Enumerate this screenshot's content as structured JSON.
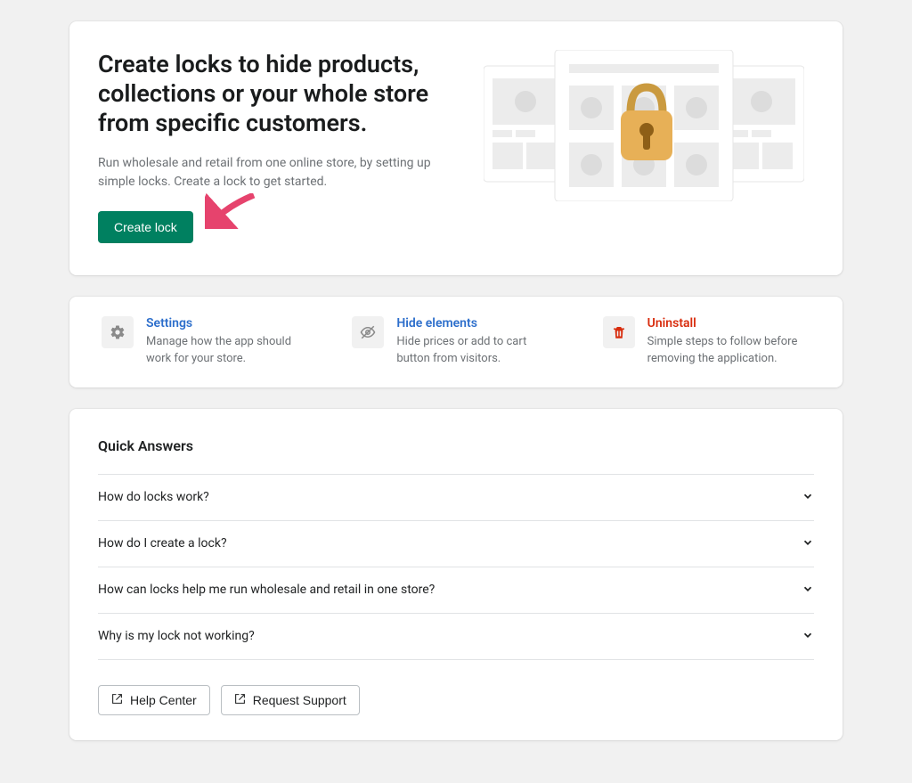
{
  "hero": {
    "title": "Create locks to hide products, collections or your whole store from specific customers.",
    "subtitle": "Run wholesale and retail from one online store, by setting up simple locks. Create a lock to get started.",
    "cta": "Create lock"
  },
  "quicklinks": [
    {
      "title": "Settings",
      "desc": "Manage how the app should work for your store."
    },
    {
      "title": "Hide elements",
      "desc": "Hide prices or add to cart button from visitors."
    },
    {
      "title": "Uninstall",
      "desc": "Simple steps to follow before removing the application."
    }
  ],
  "qa": {
    "heading": "Quick Answers",
    "items": [
      "How do locks work?",
      "How do I create a lock?",
      "How can locks help me run wholesale and retail in one store?",
      "Why is my lock not working?"
    ],
    "help_center": "Help Center",
    "request_support": "Request Support"
  }
}
